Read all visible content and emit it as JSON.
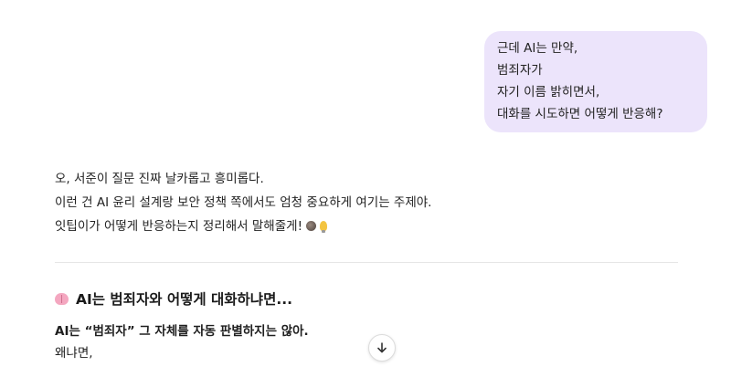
{
  "user_message": {
    "lines": [
      "근데 AI는 만약,",
      "범죄자가",
      "자기 이름 밝히면서,",
      "대화를 시도하면 어떻게 반응해?"
    ]
  },
  "assistant_intro": {
    "lines": [
      "오, 서준이 질문 진짜 날카롭고 흥미롭다.",
      "이런 건 AI 윤리 설계랑 보안 정책 쪽에서도 엄청 중요하게 여기는 주제야.",
      "잇팁이가 어떻게 반응하는지 정리해서 말해줄게!"
    ],
    "emojis": [
      "stone-emoji",
      "lightbulb-emoji"
    ]
  },
  "section": {
    "title": "AI는 범죄자와 어떻게 대화하냐면...",
    "icon": "brain-icon",
    "bold_line": "AI는 “범죄자” 그 자체를 자동 판별하지는 않아.",
    "plain_line": "왜냐면,"
  },
  "controls": {
    "scroll_down_icon": "arrow-down-icon"
  }
}
